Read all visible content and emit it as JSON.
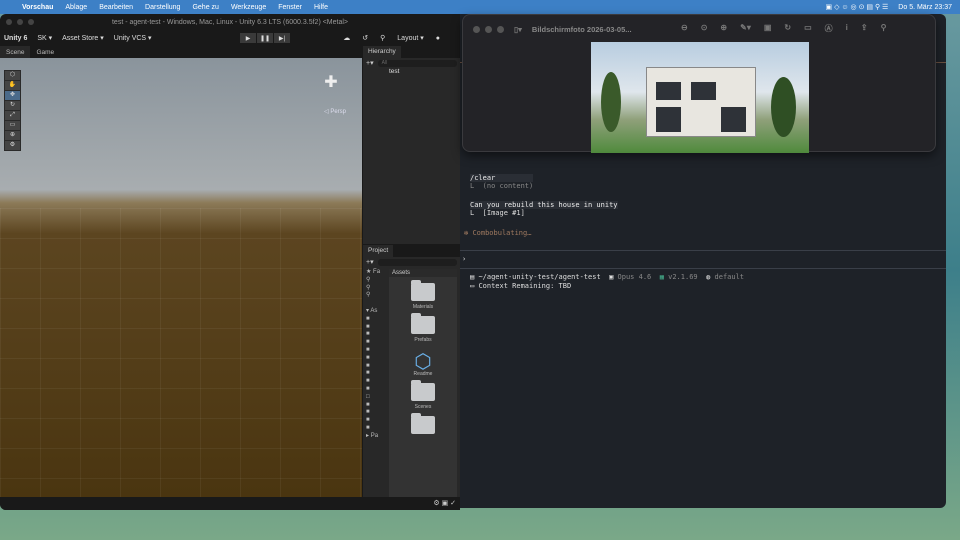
{
  "menubar": {
    "app": "Vorschau",
    "items": [
      "Ablage",
      "Bearbeiten",
      "Darstellung",
      "Gehe zu",
      "Werkzeuge",
      "Fenster",
      "Hilfe"
    ],
    "clock": "Do 5. März 23:37"
  },
  "unity": {
    "title": "test - agent-test - Windows, Mac, Linux - Unity 6.3 LTS (6000.3.5f2) <Metal>",
    "logo": "Unity 6",
    "account": "SK ▾",
    "asset_store": "Asset Store ▾",
    "vcs": "Unity VCS ▾",
    "layout": "Layout ▾",
    "tabs": {
      "scene": "Scene",
      "game": "Game"
    },
    "persp": "◁ Persp",
    "hierarchy": {
      "tab": "Hierarchy",
      "search": "All",
      "root": "test"
    },
    "project": {
      "tab": "Project",
      "breadcrumb": "Assets",
      "favorites": "Fa",
      "assets_root": "As",
      "packages": "Pa",
      "items": [
        {
          "label": "Materials",
          "type": "folder"
        },
        {
          "label": "Prefabs",
          "type": "folder"
        },
        {
          "label": "Readme",
          "type": "asset"
        },
        {
          "label": "Scenes",
          "type": "folder"
        },
        {
          "label": "",
          "type": "folder"
        }
      ]
    }
  },
  "preview": {
    "title": "Bildschirmfoto 2026-03-05..."
  },
  "terminal": {
    "lines": [
      {
        "cmd": "/clear",
        "out": "(no content)"
      },
      {
        "cmd": "Can you rebuild this house in unity",
        "out": "[Image #1]"
      }
    ],
    "status": "Combobulating…",
    "prompt": "›",
    "path": "~/agent-unity-test/agent-test",
    "model": "Opus 4.6",
    "version": "v2.1.69",
    "style": "default",
    "context": "Context Remaining: TBD"
  }
}
